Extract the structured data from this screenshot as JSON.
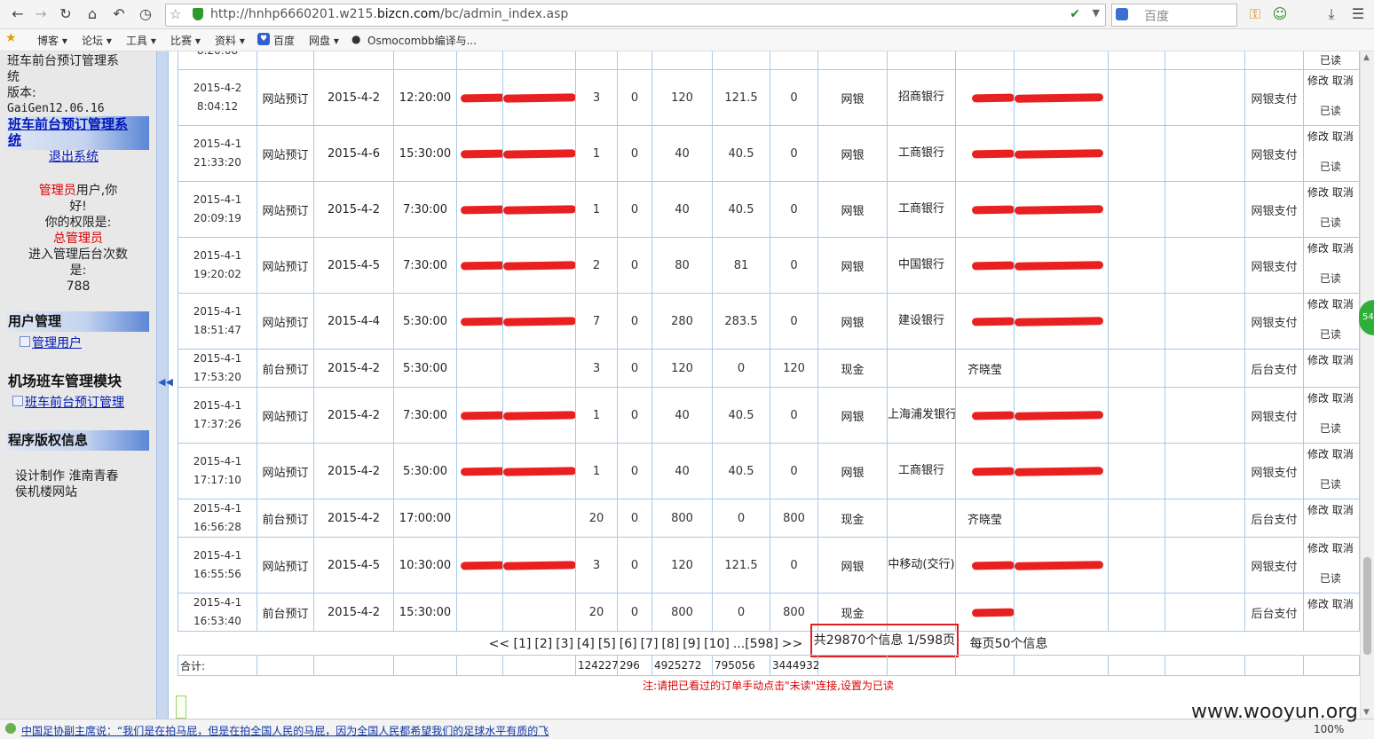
{
  "browser": {
    "url_prefix": "http://hnhp6660201.w215.",
    "url_domain": "bizcn.com",
    "url_path": "/bc/admin_index.asp",
    "search_placeholder": "百度",
    "bookmarks": [
      "博客 ▾",
      "论坛 ▾",
      "工具 ▾",
      "比赛 ▾",
      "资料 ▾",
      "百度",
      "网盘 ▾",
      "Osmocombb编译与..."
    ],
    "zoom": "100%",
    "status_news": "中国足协副主席说：“我们是在拍马屁，但是在拍全国人民的马屁，因为全国人民都希望我们的足球水平有质的飞"
  },
  "sidebar": {
    "system_title_1": "班车前台预订管理系",
    "system_title_2": "统",
    "version_label": "版本:",
    "version": "GaiGen12.06.16",
    "app_link_1": "班车前台预订管理系",
    "app_link_2": "统",
    "logout": "退出系统",
    "role_user": "管理员",
    "greet_1": "用户,你",
    "greet_2": "好!",
    "perm_label": "你的权限是:",
    "perm_value": "总管理员",
    "visits_label_1": "进入管理后台次数",
    "visits_label_2": "是:",
    "visits": "788",
    "section_users": "用户管理",
    "link_users": "管理用户",
    "section_bus": "机场班车管理模块",
    "link_bus": "班车前台预订管理",
    "section_copyright": "程序版权信息",
    "credit_1": "设计制作 淮南青春",
    "credit_2": "侯机楼网站"
  },
  "ops": {
    "edit": "修改",
    "cancel": "取消",
    "read": "已读"
  },
  "rows": [
    {
      "date": "",
      "time": "8:20:08",
      "type": "",
      "travel": "",
      "depart": "",
      "qty": "",
      "c1": "",
      "c2": "",
      "c3": "",
      "c4": "",
      "pay": "",
      "bank": "行)",
      "name": "",
      "payment": "",
      "partial": true
    },
    {
      "date": "2015-4-2",
      "time": "8:04:12",
      "type": "网站预订",
      "travel": "2015-4-2",
      "depart": "12:20:00",
      "qty": "3",
      "c1": "0",
      "c2": "120",
      "c3": "121.5",
      "c4": "0",
      "pay": "网银",
      "bank": "招商银行",
      "name": "",
      "payment": "网银支付",
      "redact": true
    },
    {
      "date": "2015-4-1",
      "time": "21:33:20",
      "type": "网站预订",
      "travel": "2015-4-6",
      "depart": "15:30:00",
      "qty": "1",
      "c1": "0",
      "c2": "40",
      "c3": "40.5",
      "c4": "0",
      "pay": "网银",
      "bank": "工商银行",
      "name": "",
      "payment": "网银支付",
      "redact": true
    },
    {
      "date": "2015-4-1",
      "time": "20:09:19",
      "type": "网站预订",
      "travel": "2015-4-2",
      "depart": "7:30:00",
      "qty": "1",
      "c1": "0",
      "c2": "40",
      "c3": "40.5",
      "c4": "0",
      "pay": "网银",
      "bank": "工商银行",
      "name": "",
      "payment": "网银支付",
      "redact": true
    },
    {
      "date": "2015-4-1",
      "time": "19:20:02",
      "type": "网站预订",
      "travel": "2015-4-5",
      "depart": "7:30:00",
      "qty": "2",
      "c1": "0",
      "c2": "80",
      "c3": "81",
      "c4": "0",
      "pay": "网银",
      "bank": "中国银行",
      "name": "",
      "payment": "网银支付",
      "redact": true
    },
    {
      "date": "2015-4-1",
      "time": "18:51:47",
      "type": "网站预订",
      "travel": "2015-4-4",
      "depart": "5:30:00",
      "qty": "7",
      "c1": "0",
      "c2": "280",
      "c3": "283.5",
      "c4": "0",
      "pay": "网银",
      "bank": "建设银行",
      "name": "",
      "payment": "网银支付",
      "redact": true
    },
    {
      "date": "2015-4-1",
      "time": "17:53:20",
      "type": "前台预订",
      "travel": "2015-4-2",
      "depart": "5:30:00",
      "qty": "3",
      "c1": "0",
      "c2": "120",
      "c3": "0",
      "c4": "120",
      "pay": "现金",
      "bank": "",
      "name": "齐晓莹",
      "payment": "后台支付",
      "short": true
    },
    {
      "date": "2015-4-1",
      "time": "17:37:26",
      "type": "网站预订",
      "travel": "2015-4-2",
      "depart": "7:30:00",
      "qty": "1",
      "c1": "0",
      "c2": "40",
      "c3": "40.5",
      "c4": "0",
      "pay": "网银",
      "bank": "上海浦发银行",
      "name": "",
      "payment": "网银支付",
      "redact": true
    },
    {
      "date": "2015-4-1",
      "time": "17:17:10",
      "type": "网站预订",
      "travel": "2015-4-2",
      "depart": "5:30:00",
      "qty": "1",
      "c1": "0",
      "c2": "40",
      "c3": "40.5",
      "c4": "0",
      "pay": "网银",
      "bank": "工商银行",
      "name": "",
      "payment": "网银支付",
      "redact": true
    },
    {
      "date": "2015-4-1",
      "time": "16:56:28",
      "type": "前台预订",
      "travel": "2015-4-2",
      "depart": "17:00:00",
      "qty": "20",
      "c1": "0",
      "c2": "800",
      "c3": "0",
      "c4": "800",
      "pay": "现金",
      "bank": "",
      "name": "齐晓莹",
      "payment": "后台支付",
      "short": true
    },
    {
      "date": "2015-4-1",
      "time": "16:55:56",
      "type": "网站预订",
      "travel": "2015-4-5",
      "depart": "10:30:00",
      "qty": "3",
      "c1": "0",
      "c2": "120",
      "c3": "121.5",
      "c4": "0",
      "pay": "网银",
      "bank": "中移动(交行)",
      "name": "",
      "payment": "网银支付",
      "redact": true
    },
    {
      "date": "2015-4-1",
      "time": "16:53:40",
      "type": "前台预订",
      "travel": "2015-4-2",
      "depart": "15:30:00",
      "qty": "20",
      "c1": "0",
      "c2": "800",
      "c3": "0",
      "c4": "800",
      "pay": "现金",
      "bank": "",
      "name": "",
      "payment": "后台支付",
      "short": true,
      "redact_name": true
    }
  ],
  "pager": {
    "prev": "<<",
    "pages": [
      "[1]",
      "[2]",
      "[3]",
      "[4]",
      "[5]",
      "[6]",
      "[7]",
      "[8]",
      "[9]",
      "[10]",
      "...[598]",
      ">>"
    ],
    "total_info": "共29870个信息 1/598页",
    "per_page": "每页50个信息"
  },
  "totals": {
    "label": "合计:",
    "qty": "124227",
    "c1": "296",
    "c2": "4925272",
    "c3": "795056",
    "c4": "3444932"
  },
  "note": "注:请把已看过的订单手动点击\"未读\"连接,设置为已读",
  "watermark": "www.wooyun.org",
  "badge": "54"
}
